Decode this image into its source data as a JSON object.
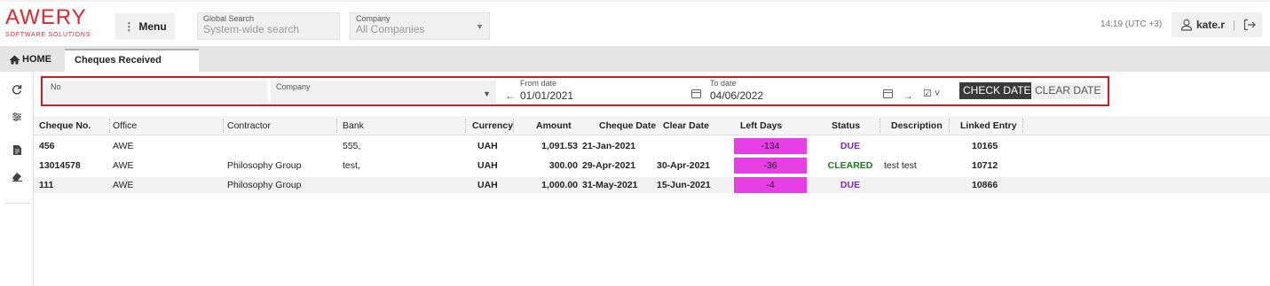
{
  "logo": {
    "main": "AWERY",
    "sub": "SOFTWARE SOLUTIONS"
  },
  "header": {
    "menu_label": "Menu",
    "global_search_label": "Global Search",
    "global_search_placeholder": "System-wide search",
    "company_label": "Company",
    "company_value": "All Companies",
    "time": "14:19 (UTC +3)",
    "username": "kate.r"
  },
  "tabs": {
    "home_label": "HOME",
    "active_label": "Cheques Received"
  },
  "filters": {
    "no_label": "No",
    "no_value": "",
    "company_label": "Company",
    "company_value": "",
    "from_label": "From date",
    "from_value": "01/01/2021",
    "to_label": "To date",
    "to_value": "04/06/2022",
    "check_date_label": "CHECK DATE",
    "clear_date_label": "CLEAR DATE"
  },
  "columns": [
    "Cheque No.",
    "Office",
    "Contractor",
    "Bank",
    "Currency",
    "Amount",
    "Cheque Date",
    "Clear Date",
    "Left Days",
    "Status",
    "Description",
    "Linked Entry"
  ],
  "rows": [
    {
      "cheque_no": "456",
      "office": "AWE",
      "contractor": "",
      "bank": "555,",
      "currency": "UAH",
      "amount": "1,091.53",
      "cheque_date": "21-Jan-2021",
      "clear_date": "",
      "left_days": "-134",
      "status": "DUE",
      "description": "",
      "linked_entry": "10165"
    },
    {
      "cheque_no": "13014578",
      "office": "AWE",
      "contractor": "Philosophy Group",
      "bank": "test,",
      "currency": "UAH",
      "amount": "300.00",
      "cheque_date": "29-Apr-2021",
      "clear_date": "30-Apr-2021",
      "left_days": "-36",
      "status": "CLEARED",
      "description": "test test",
      "linked_entry": "10712"
    },
    {
      "cheque_no": "111",
      "office": "AWE",
      "contractor": "Philosophy Group",
      "bank": "",
      "currency": "UAH",
      "amount": "1,000.00",
      "cheque_date": "31-May-2021",
      "clear_date": "15-Jun-2021",
      "left_days": "-4",
      "status": "DUE",
      "description": "",
      "linked_entry": "10866"
    }
  ],
  "colors": {
    "brand_red": "#e2262d",
    "left_days_bg": "#e83ee6",
    "due": "#7b2ab3",
    "cleared": "#1d7d1d",
    "highlight_border": "#e0141b"
  },
  "icons": {
    "rail": [
      "refresh-icon",
      "sliders-icon",
      "document-icon",
      "eraser-icon"
    ]
  }
}
